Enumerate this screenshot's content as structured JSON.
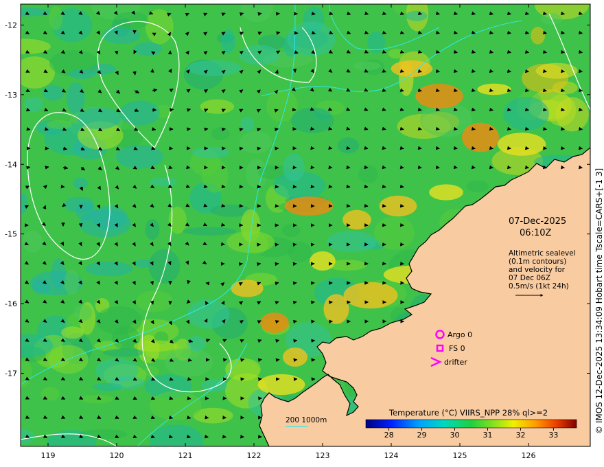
{
  "map": {
    "lon_range": [
      118.6,
      126.9
    ],
    "lat_range": [
      -18.05,
      -11.7
    ],
    "lon_ticks": [
      "119",
      "120",
      "121",
      "122",
      "123",
      "124",
      "125",
      "126"
    ],
    "lat_ticks": [
      "-12",
      "-13",
      "-14",
      "-15",
      "-16",
      "-17"
    ],
    "land_color": "#f8cba0",
    "datetime": {
      "date": "07-Dec-2025",
      "time": "06:10Z"
    },
    "description": [
      "Altimetric sealevel",
      "(0.1m contours)",
      "and velocity for",
      "07 Dec 06Z",
      "0.5m/s (1kt 24h)"
    ],
    "legend": {
      "argo": {
        "label": "Argo 0",
        "color": "#ff00ff",
        "icon": "circle-icon"
      },
      "fs": {
        "label": "FS 0",
        "color": "#ff00ff",
        "icon": "square-icon"
      },
      "drifter": {
        "label": "drifter",
        "color": "#ff00ff",
        "icon": "chevron-icon"
      }
    },
    "isobath_label": "200  1000m",
    "colorbar": {
      "title": "Temperature (°C) VIIRS_NPP 28% ql>=2",
      "range": [
        27.3,
        33.7
      ],
      "ticks": [
        "28",
        "29",
        "30",
        "31",
        "32",
        "33"
      ]
    },
    "credit": "© IMOS 12-Dec-2025 13:34:09 Hobart time Tscale=CARS+[-1 3]"
  }
}
